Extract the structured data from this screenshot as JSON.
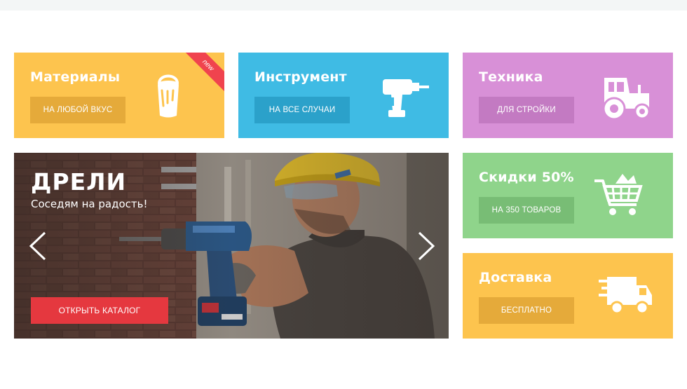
{
  "tiles": {
    "materials": {
      "title": "Материалы",
      "button": "на любой вкус",
      "badge": "new",
      "icon": "paint-bucket-icon",
      "color": "#fdc44e"
    },
    "tools": {
      "title": "Инструмент",
      "button": "на все случаи",
      "icon": "drill-icon",
      "color": "#3fbbe4"
    },
    "machinery": {
      "title": "Техника",
      "button": "для стройки",
      "icon": "tractor-icon",
      "color": "#d890d7"
    },
    "discount": {
      "title": "Скидки 50%",
      "button": "на 350 товаров",
      "icon": "shopping-cart-icon",
      "color": "#8fd48b"
    },
    "delivery": {
      "title": "Доставка",
      "button": "бесплатно",
      "icon": "delivery-truck-icon",
      "color": "#fdc44e"
    }
  },
  "hero": {
    "title": "ДРЕЛИ",
    "subtitle": "Соседям на радость!",
    "button": "открыть каталог",
    "button_color": "#e5383f",
    "prev_icon": "chevron-left-icon",
    "next_icon": "chevron-right-icon"
  }
}
